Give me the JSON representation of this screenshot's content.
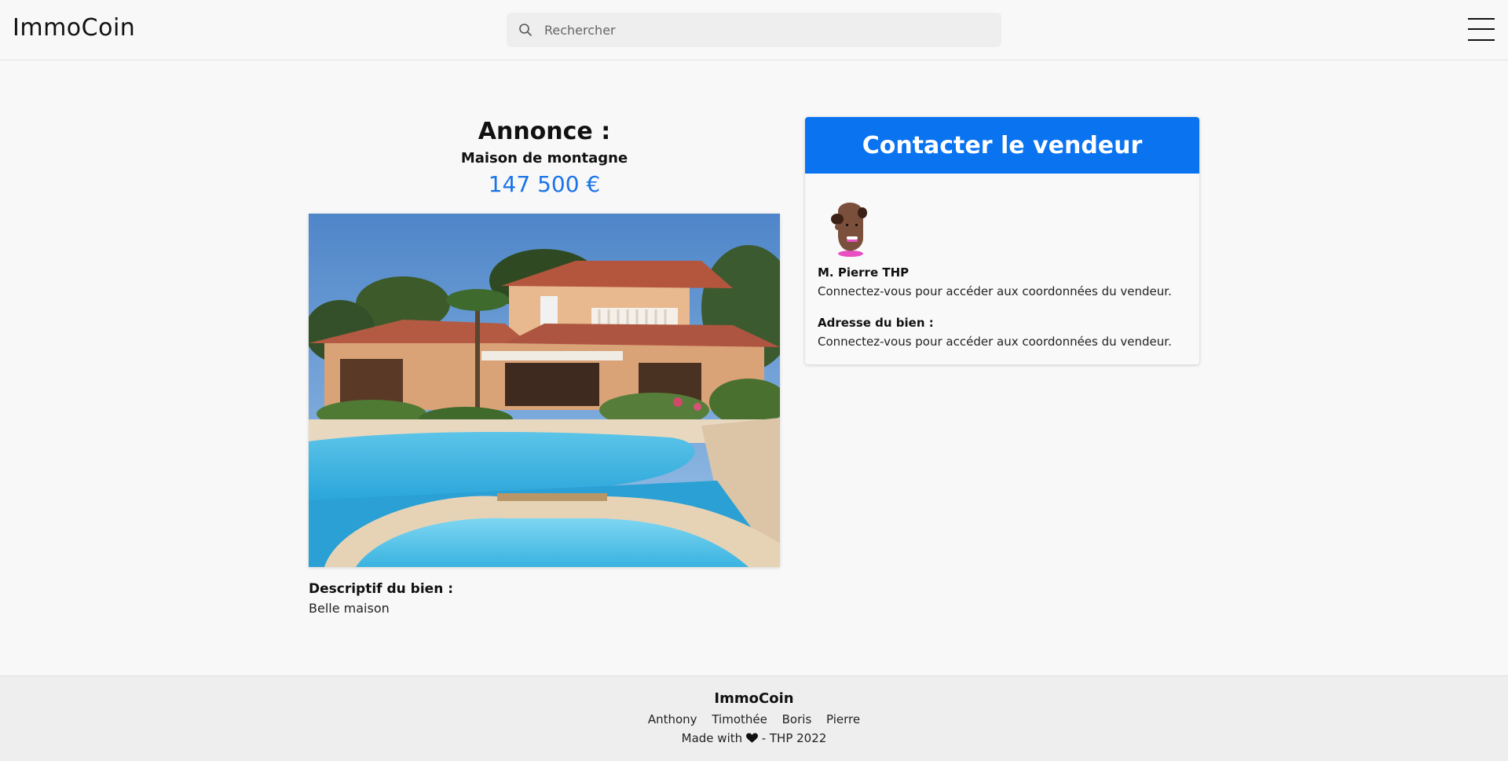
{
  "header": {
    "brand": "ImmoCoin",
    "search": {
      "placeholder": "Rechercher",
      "value": ""
    },
    "menu_icon": "hamburger-menu-icon"
  },
  "listing": {
    "heading": "Annonce :",
    "title": "Maison de montagne",
    "price": "147 500 €",
    "photo_description": "House with swimming pool",
    "description_label": "Descriptif du bien :",
    "description": "Belle maison"
  },
  "contact": {
    "header": "Contacter le vendeur",
    "seller_name": "M. Pierre THP",
    "seller_info": "Connectez-vous pour accéder aux coordonnées du vendeur.",
    "address_label": "Adresse du bien :",
    "address_info": "Connectez-vous pour accéder aux coordonnées du vendeur."
  },
  "footer": {
    "brand": "ImmoCoin",
    "authors": [
      "Anthony",
      "Timothée",
      "Boris",
      "Pierre"
    ],
    "credit_prefix": "Made with",
    "credit_suffix": "- THP 2022"
  },
  "colors": {
    "accent": "#0a73f0",
    "price": "#1a73e8",
    "background": "#f8f8f8"
  }
}
